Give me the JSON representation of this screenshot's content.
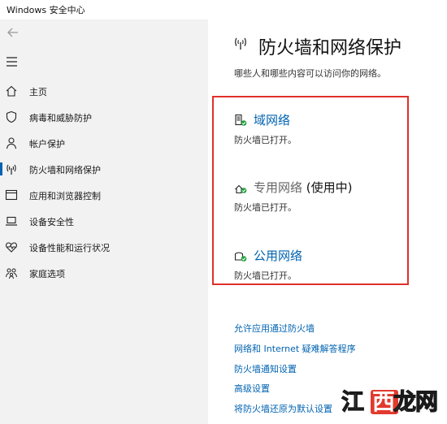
{
  "window": {
    "title": "Windows 安全中心"
  },
  "sidebar": {
    "items": [
      {
        "label": "主页",
        "icon": "home-icon"
      },
      {
        "label": "病毒和威胁防护",
        "icon": "shield-icon"
      },
      {
        "label": "帐户保护",
        "icon": "person-icon"
      },
      {
        "label": "防火墙和网络保护",
        "icon": "wifi-antenna-icon",
        "active": true
      },
      {
        "label": "应用和浏览器控制",
        "icon": "browser-window-icon"
      },
      {
        "label": "设备安全性",
        "icon": "laptop-icon"
      },
      {
        "label": "设备性能和运行状况",
        "icon": "heart-pulse-icon"
      },
      {
        "label": "家庭选项",
        "icon": "family-icon"
      }
    ]
  },
  "main": {
    "title": "防火墙和网络保护",
    "description": "哪些人和哪些内容可以访问你的网络。",
    "networks": [
      {
        "name": "域网络",
        "status": "防火墙已打开。",
        "icon": "domain-network-icon"
      },
      {
        "name": "专用网络",
        "tag": " (使用中)",
        "status": "防火墙已打开。",
        "icon": "private-network-icon"
      },
      {
        "name": "公用网络",
        "status": "防火墙已打开。",
        "icon": "public-network-icon"
      }
    ],
    "links": [
      "允许应用通过防火墙",
      "网络和 Internet 疑难解答程序",
      "防火墙通知设置",
      "高级设置",
      "将防火墙还原为默认设置"
    ]
  },
  "watermark": {
    "text": "江西龙网"
  },
  "colors": {
    "accent": "#0063b1",
    "highlight": "#e0302b",
    "status_ok": "#1e9e3a"
  }
}
